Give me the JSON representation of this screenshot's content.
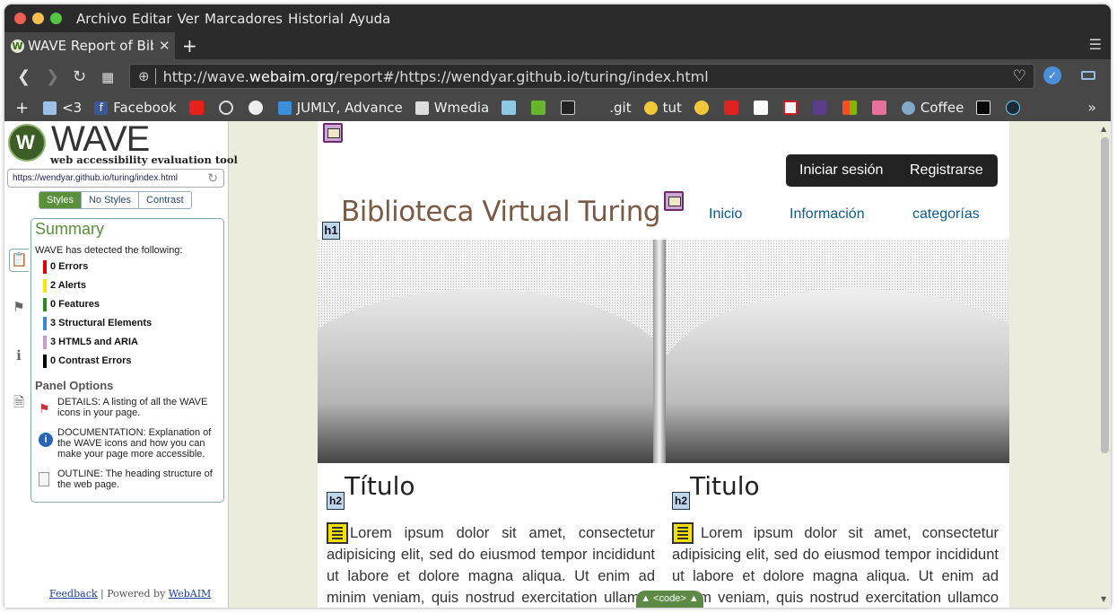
{
  "menubar": {
    "items": [
      "Archivo",
      "Editar",
      "Ver",
      "Marcadores",
      "Historial",
      "Ayuda"
    ]
  },
  "colors": {
    "close": "#ed5f55",
    "minimize": "#f5be4f",
    "maximize": "#58c544",
    "wave_green": "#5a8f3c",
    "errors": "#e00000",
    "alerts": "#f5e800",
    "features": "#2d8a1e",
    "structural": "#3a87d1",
    "aria": "#c89ad6",
    "contrast": "#000000"
  },
  "tab": {
    "title": "WAVE Report of Bibl",
    "favicon": "wave-icon"
  },
  "url": {
    "prefix": "http://wave.",
    "domain": "webaim.org",
    "rest": "/report#/https://wendyar.github.io/turing/index.html"
  },
  "bookmarks": [
    {
      "label": "<3",
      "icon": "folder-icon"
    },
    {
      "label": "Facebook",
      "icon": "facebook-icon"
    },
    {
      "label": "JUMLY, Advance",
      "icon": "jumly-icon"
    },
    {
      "label": "Wmedia",
      "icon": "file-icon"
    },
    {
      "label": ".git",
      "icon": "git-icon"
    },
    {
      "label": "tut",
      "icon": "python-icon"
    },
    {
      "label": "Coffee",
      "icon": "coffee-icon"
    }
  ],
  "wave": {
    "logo_word": "WAVE",
    "subtitle": "web accessibility evaluation tool",
    "url": "https://wendyar.github.io/turing/index.html",
    "tabs": [
      "Styles",
      "No Styles",
      "Contrast"
    ],
    "summary_title": "Summary",
    "detected": "WAVE has detected the following:",
    "results": [
      {
        "label": "0 Errors",
        "color": "#e00000"
      },
      {
        "label": "2 Alerts",
        "color": "#f5e800"
      },
      {
        "label": "0 Features",
        "color": "#2d8a1e"
      },
      {
        "label": "3 Structural Elements",
        "color": "#3a87d1"
      },
      {
        "label": "3 HTML5 and ARIA",
        "color": "#c89ad6"
      },
      {
        "label": "0 Contrast Errors",
        "color": "#000000"
      }
    ],
    "panel_options": "Panel Options",
    "options": [
      {
        "text": "DETAILS: A listing of all the WAVE icons in your page.",
        "icon": "flag-icon"
      },
      {
        "text": "DOCUMENTATION: Explanation of the WAVE icons and how you can make your page more accessible.",
        "icon": "info-icon"
      },
      {
        "text": "OUTLINE: The heading structure of the web page.",
        "icon": "outline-icon"
      }
    ],
    "footer": {
      "feedback": "Feedback",
      "sep": " | Powered by ",
      "webaim": "WebAIM"
    }
  },
  "site": {
    "login": "Iniciar sesión",
    "register": "Registrarse",
    "h1_tag": "h1",
    "title": "Biblioteca Virtual Turing",
    "nav": [
      "Inicio",
      "Información",
      "categorías"
    ],
    "h2_tag": "h2",
    "columns": [
      {
        "heading": "Título",
        "text": "Lorem ipsum dolor sit amet, consectetur adipisicing elit, sed do eiusmod tempor incididunt ut labore et dolore magna aliqua. Ut enim ad minim veniam, quis nostrud exercitation ullamco laboris"
      },
      {
        "heading": "Titulo",
        "text": "Lorem ipsum dolor sit amet, consectetur adipisicing elit, sed do eiusmod tempor incididunt ut labore et dolore magna aliqua. Ut enim ad minim veniam, quis nostrud exercitation ullamco laboris"
      }
    ],
    "code_toggle": "▲ <code> ▲"
  }
}
